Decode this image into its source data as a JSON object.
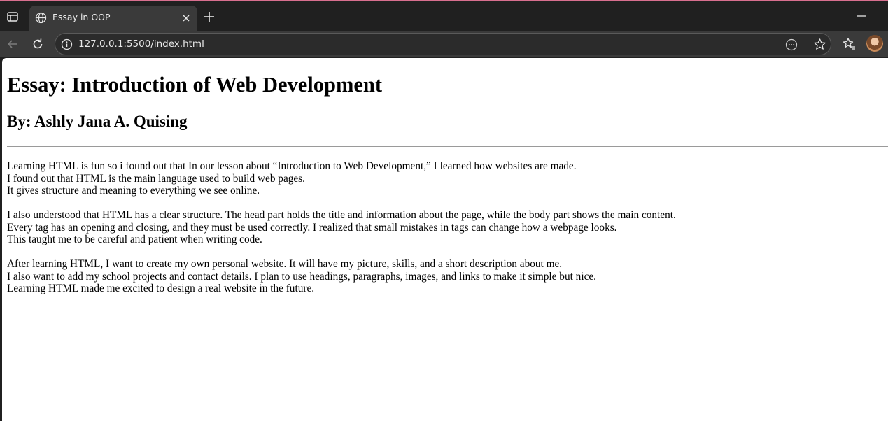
{
  "browser": {
    "tab": {
      "title": "Essay in OOP"
    },
    "address_bar": {
      "url": "127.0.0.1:5500/index.html"
    },
    "icons": {
      "sidebar": "sidebar-icon",
      "tab_favicon": "globe-icon",
      "close": "close-icon",
      "new_tab": "plus-icon",
      "minimize": "minimize-icon",
      "back": "back-arrow-icon",
      "reload": "reload-icon",
      "site_info": "info-icon",
      "more": "more-icon",
      "favorite": "star-icon",
      "favorites": "favorites-icon",
      "profile": "avatar"
    }
  },
  "page": {
    "title": "Essay: Introduction of Web Development",
    "author": "By: Ashly Jana A. Quising",
    "paragraphs": [
      {
        "lines": [
          "Learning HTML is fun so i found out that In our lesson about “Introduction to Web Development,” I learned how websites are made.",
          "I found out that HTML is the main language used to build web pages.",
          "It gives structure and meaning to everything we see online."
        ]
      },
      {
        "lines": [
          "I also understood that HTML has a clear structure. The head part holds the title and information about the page, while the body part shows the main content.",
          "Every tag has an opening and closing, and they must be used correctly. I realized that small mistakes in tags can change how a webpage looks.",
          "This taught me to be careful and patient when writing code."
        ]
      },
      {
        "lines": [
          "After learning HTML, I want to create my own personal website. It will have my picture, skills, and a short description about me.",
          "I also want to add my school projects and contact details. I plan to use headings, paragraphs, images, and links to make it simple but nice.",
          "Learning HTML made me excited to design a real website in the future."
        ]
      }
    ]
  },
  "colors": {
    "chrome_dark": "#202020",
    "chrome_toolbar": "#3a3a3a",
    "accent_line": "#d86f8f",
    "page_background": "#ffffff"
  }
}
